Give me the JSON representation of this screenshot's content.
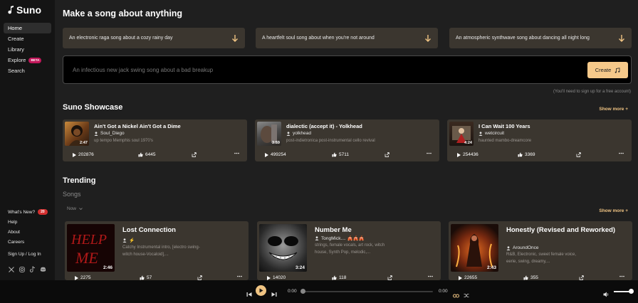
{
  "brand": {
    "name": "Suno"
  },
  "sidebar": {
    "items": [
      {
        "label": "Home",
        "active": true
      },
      {
        "label": "Create"
      },
      {
        "label": "Library"
      },
      {
        "label": "Explore",
        "badge": "BETA"
      },
      {
        "label": "Search"
      }
    ],
    "bottom": {
      "whats_new": "What's New?",
      "whats_new_count": "20",
      "help": "Help",
      "about": "About",
      "careers": "Careers",
      "signup": "Sign Up / Log In"
    },
    "socials": [
      "x-icon",
      "instagram-icon",
      "tiktok-icon",
      "discord-icon"
    ]
  },
  "main": {
    "heading": "Make a song about anything",
    "suggestions": [
      "An electronic raga song about a cozy rainy day",
      "A heartfelt soul song about when you're not around",
      "An atmospheric synthwave song about dancing all night long"
    ],
    "prompt": {
      "placeholder": "An infectious new jack swing song about a bad breakup",
      "create_label": "Create"
    },
    "signup_note": "(You'll need to sign up for a free account)",
    "showcase": {
      "title": "Suno Showcase",
      "show_more": "Show more +",
      "cards": [
        {
          "title": "Ain't Got a Nickel Ain't Got a Dime",
          "user": "Soul_Diego",
          "desc": "up tempo Memphis soul 1970's",
          "duration": "2:47",
          "plays": "202876",
          "likes": "6445"
        },
        {
          "title": "dialectic (accept it) - Yolkhead",
          "user": "yolkhead",
          "desc": "post-indietronica post-instrumental cello revival",
          "duration": "3:59",
          "plays": "499254",
          "likes": "5711"
        },
        {
          "title": "I Can Wait 100 Years",
          "user": "wetcircuit",
          "desc": "haunted mambo-dreamcore",
          "duration": "4:24",
          "plays": "254436",
          "likes": "3369"
        }
      ]
    },
    "trending": {
      "title": "Trending",
      "subtitle": "Songs",
      "filter": "Now",
      "show_more": "Show more +",
      "cards": [
        {
          "title": "Lost Connection",
          "user": "⚡",
          "desc": "Catchy Instrumental intro, [electro swing- witch house-Vocaloid],...",
          "duration": "2:46",
          "plays": "2275",
          "likes": "57"
        },
        {
          "title": "Number Me",
          "user": "TongMick.... 🎪🎪🎪",
          "desc": "strings, female vocals, art rock, witch house, Synth Pop, melodic,...",
          "duration": "3:24",
          "plays": "14020",
          "likes": "118"
        },
        {
          "title": "Honestly (Revised and Reworked)",
          "user": "AroundOnce",
          "desc": "R&B, Electronic, sweet female voice, eerie, swing, dreamy,...",
          "duration": "2:43",
          "plays": "22655",
          "likes": "355"
        }
      ]
    }
  },
  "player": {
    "current_time": "0:00",
    "total_time": "0:00",
    "progress": 0,
    "volume": 0.85
  }
}
